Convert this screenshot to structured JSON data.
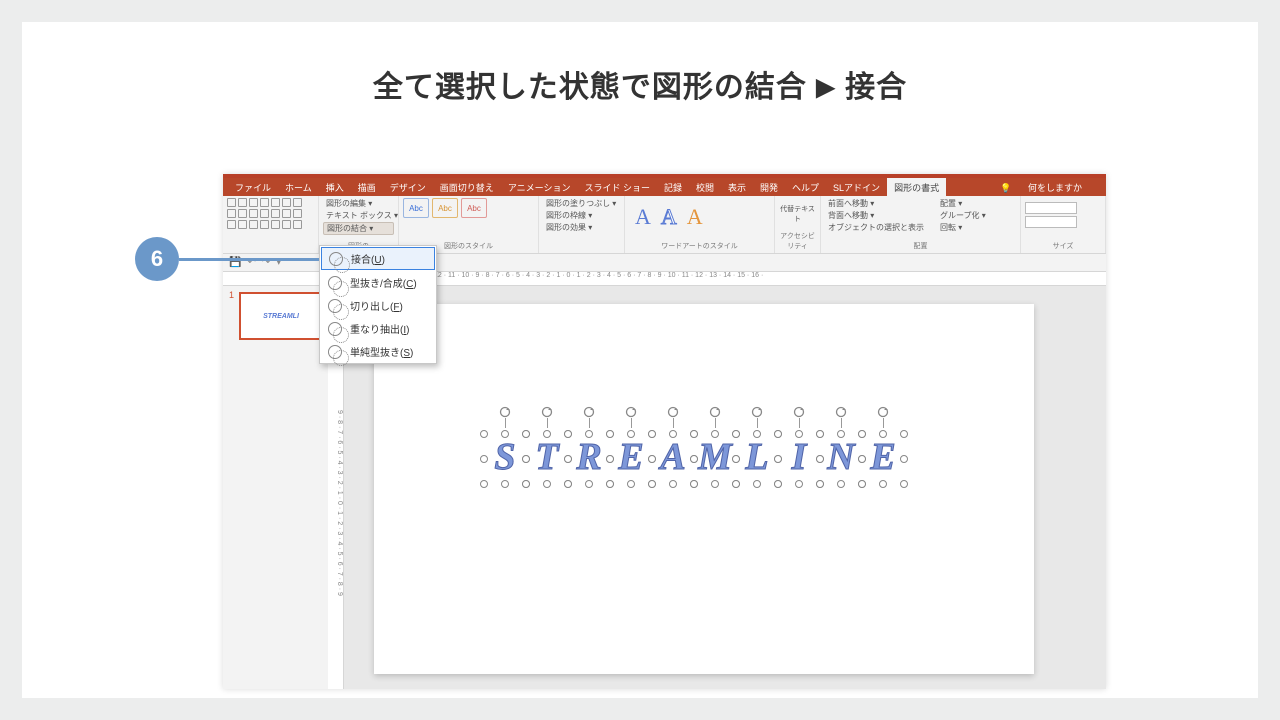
{
  "heading": {
    "a": "全て選択した状態で図形の結合",
    "arrow": "▶",
    "b": "接合"
  },
  "callout": {
    "num": "6"
  },
  "menu": {
    "items": [
      "ファイル",
      "ホーム",
      "挿入",
      "描画",
      "デザイン",
      "画面切り替え",
      "アニメーション",
      "スライド ショー",
      "記録",
      "校閲",
      "表示",
      "開発",
      "ヘルプ",
      "SLアドイン"
    ],
    "active": "図形の書式",
    "tell_icon": "💡",
    "tell": "何をしますか"
  },
  "ribbon": {
    "insert": {
      "edit": "図形の編集 ▾",
      "textbox": "テキスト ボックス ▾",
      "merge": "図形の結合 ▾",
      "glabel": "図形の"
    },
    "abc": "Abc",
    "styles": {
      "fill": "図形の塗りつぶし ▾",
      "outline": "図形の枠線 ▾",
      "effects": "図形の効果 ▾",
      "glabel": "図形のスタイル"
    },
    "wordart": {
      "glabel": "ワードアートのスタイル",
      "A": "A"
    },
    "alt": {
      "btn": "代替テキスト",
      "glabel": "アクセシビリティ"
    },
    "arrange": {
      "front": "前面へ移動 ▾",
      "back": "背面へ移動 ▾",
      "select": "オブジェクトの選択と表示",
      "align": "配置 ▾",
      "group": "グループ化 ▾",
      "rotate": "回転 ▾",
      "glabel": "配置"
    },
    "size": {
      "glabel": "サイズ"
    }
  },
  "ruler": "16 · 15 · 14 · 13 · 12 · 11 · 10 · 9 · 8 · 7 · 6 · 5 · 4 · 3 · 2 · 1 · 0 · 1 · 2 · 3 · 4 · 5 · 6 · 7 · 8 · 9 · 10 · 11 · 12 · 13 · 14 · 15 · 16 ·",
  "vruler": "9 · 8 · 7 · 6 · 5 · 4 · 3 · 2 · 1 · 0 · 1 · 2 · 3 · 4 · 5 · 6 · 7 · 8 · 9",
  "dropdown": {
    "union": {
      "label": "接合(",
      "key": "U",
      "close": ")"
    },
    "combine": {
      "label": "型抜き/合成(",
      "key": "C",
      "close": ")"
    },
    "fragment": {
      "label": "切り出し(",
      "key": "F",
      "close": ")"
    },
    "intersect": {
      "label": "重なり抽出(",
      "key": "I",
      "close": ")"
    },
    "subtract": {
      "label": "単純型抜き(",
      "key": "S",
      "close": ")"
    }
  },
  "thumb": {
    "num": "1",
    "text": "STREAMLI"
  },
  "canvas": {
    "word": "STREAMLINE"
  }
}
